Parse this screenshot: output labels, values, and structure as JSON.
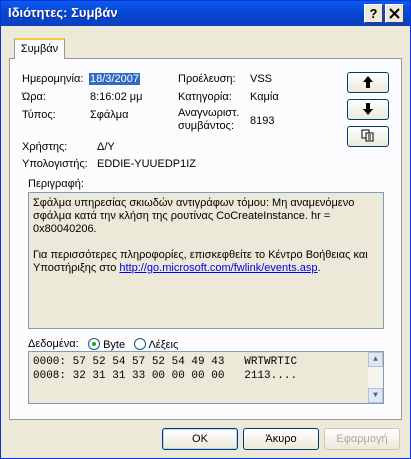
{
  "window": {
    "title": "Ιδιότητες: Συμβάν",
    "help_label": "?",
    "close_label": "X"
  },
  "tab": {
    "label": "Συμβάν"
  },
  "fields": {
    "date_label": "Ημερομηνία:",
    "date_value": "18/3/2007",
    "time_label": "Ώρα:",
    "time_value": "8:16:02 μμ",
    "type_label": "Τύπος:",
    "type_value": "Σφάλμα",
    "user_label": "Χρήστης:",
    "user_value": "Δ/Υ",
    "computer_label": "Υπολογιστής:",
    "computer_value": "EDDIE-YUUEDP1IZ",
    "source_label": "Προέλευση:",
    "source_value": "VSS",
    "category_label": "Κατηγορία:",
    "category_value": "Καμία",
    "event_id_label_1": "Αναγνωριστ.",
    "event_id_label_2": "συμβάντος:",
    "event_id_value": "8193"
  },
  "description": {
    "label": "Περιγραφή:",
    "para1": "Σφάλμα υπηρεσίας σκιωδών αντιγράφων τόμου: Μη αναμενόμενο σφάλμα κατά την κλήση της ρουτίνας CoCreateInstance.  hr = 0x80040206.",
    "para2_prefix": "Για περισσότερες πληροφορίες, επισκεφθείτε το Κέντρο Βοήθειας και Υποστήριξης στο ",
    "link": "http://go.microsoft.com/fwlink/events.asp",
    "para2_suffix": "."
  },
  "data": {
    "label": "Δεδομένα:",
    "radio_bytes": "Byte",
    "radio_words": "Λέξεις",
    "selected": "Byte",
    "line1": "0000: 57 52 54 57 52 54 49 43   WRTWRTIC",
    "line2": "0008: 32 31 31 33 00 00 00 00   2113...."
  },
  "buttons": {
    "ok": "OK",
    "cancel": "Άκυρο",
    "apply": "Εφαρμογή"
  }
}
